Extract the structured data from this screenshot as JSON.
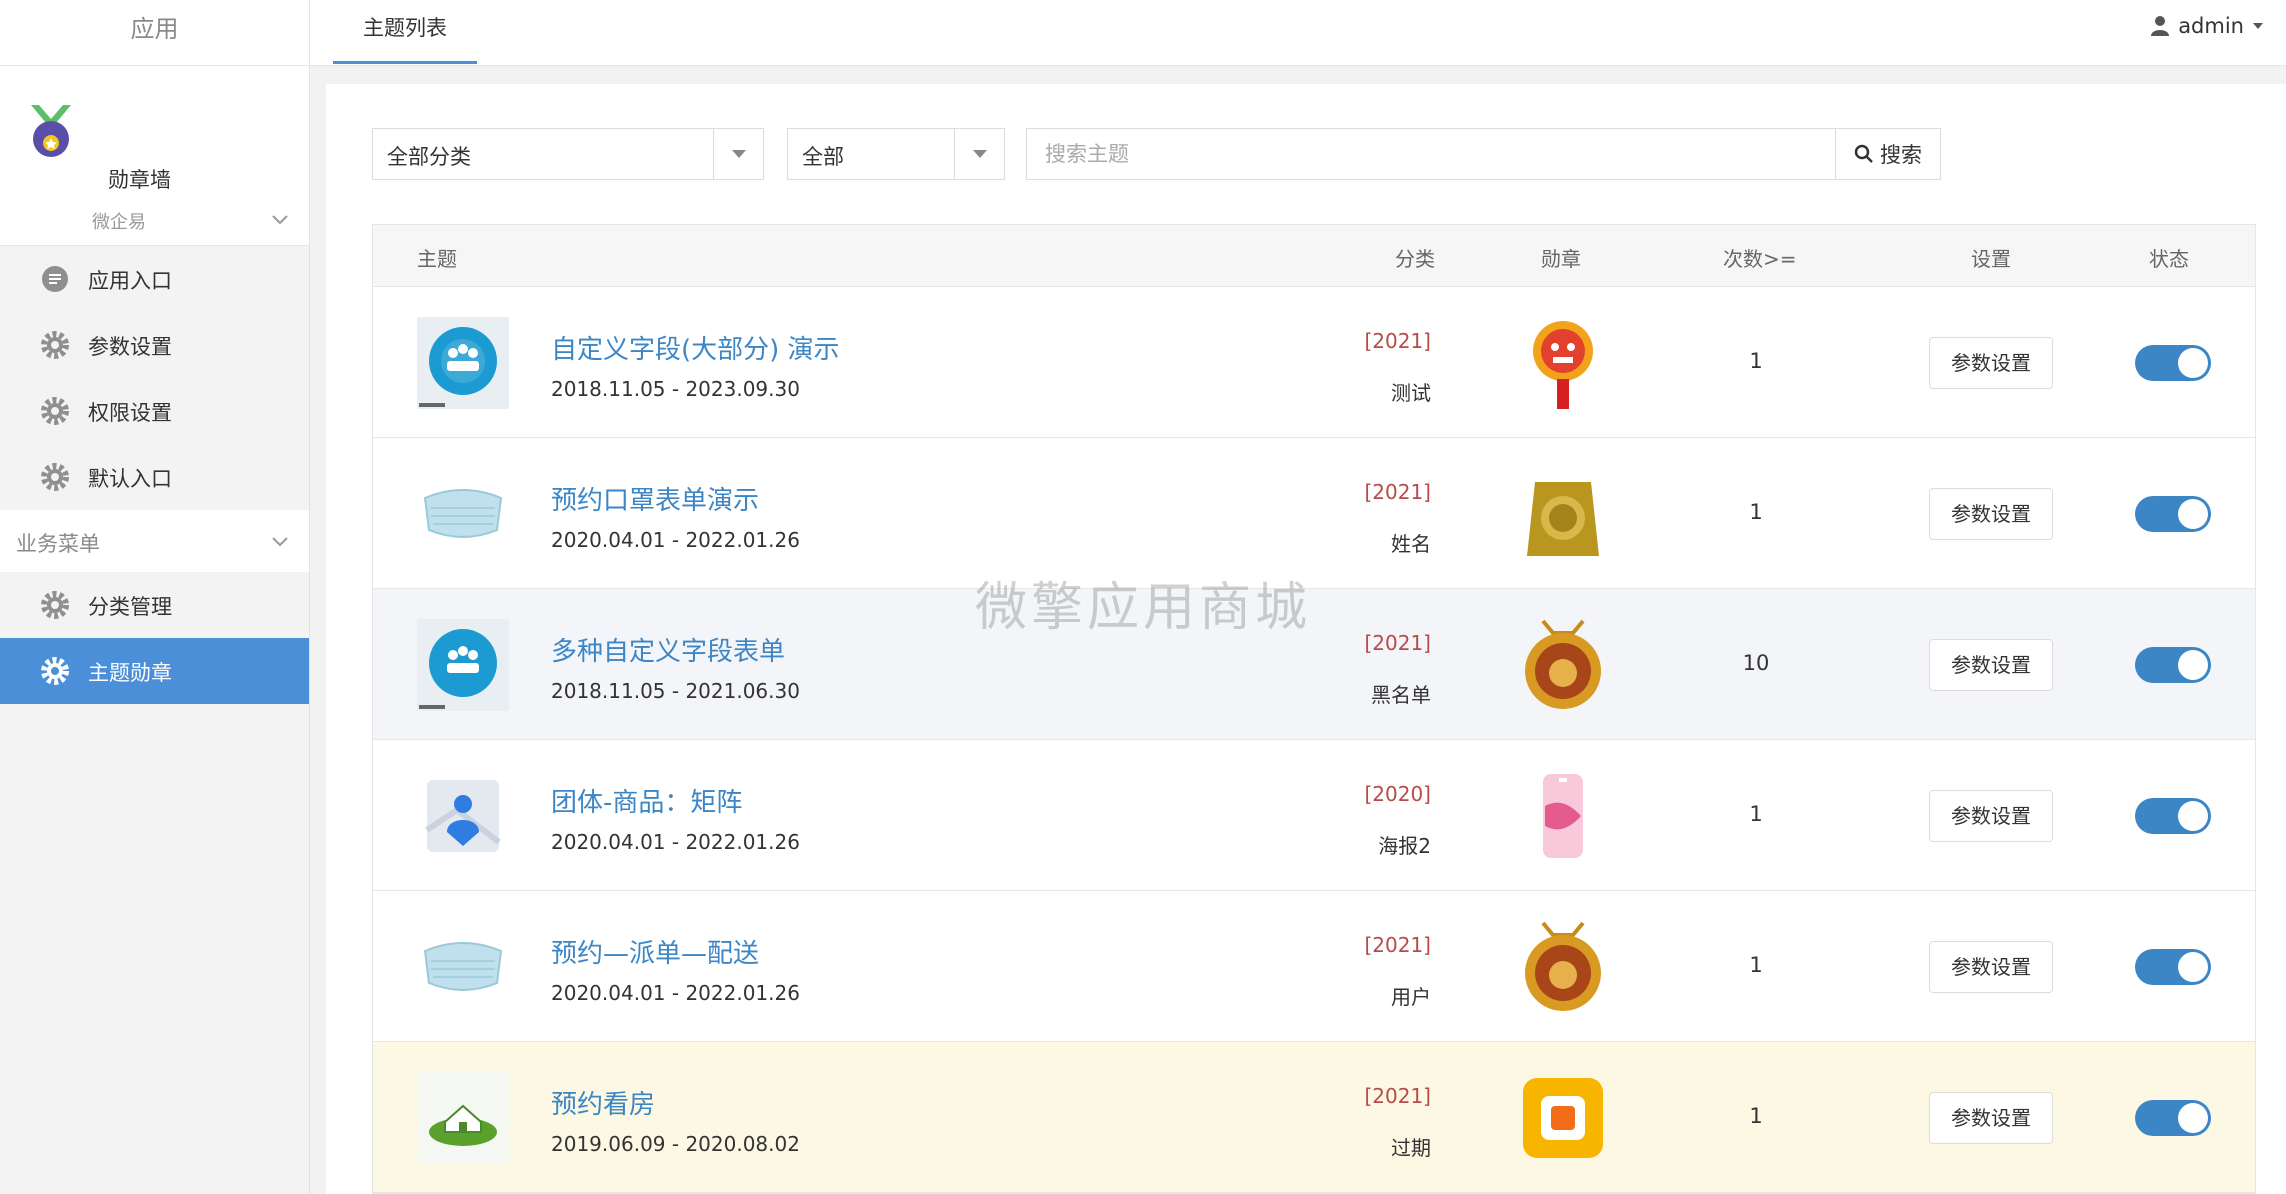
{
  "sidebar": {
    "title": "应用",
    "app_name": "勋章墙",
    "group_label": "微企易",
    "items": [
      {
        "label": "应用入口"
      },
      {
        "label": "参数设置"
      },
      {
        "label": "权限设置"
      },
      {
        "label": "默认入口"
      }
    ],
    "section_label": "业务菜单",
    "section_items": [
      {
        "label": "分类管理"
      },
      {
        "label": "主题勋章"
      }
    ]
  },
  "topbar": {
    "tab": "主题列表",
    "user": "admin"
  },
  "filters": {
    "category": "全部分类",
    "status": "全部",
    "search_placeholder": "搜索主题",
    "search_button": "搜索"
  },
  "table": {
    "headers": [
      "主题",
      "分类",
      "勋章",
      "次数>=",
      "设置",
      "状态"
    ],
    "rows": [
      {
        "title": "自定义字段(大部分) 演示",
        "dates": "2018.11.05 - 2023.09.30",
        "year": "[2021]",
        "category": "测试",
        "count": "1",
        "button": "参数设置",
        "thumb": "people-icon",
        "medal": "lion-medal"
      },
      {
        "title": "预约口罩表单演示",
        "dates": "2020.04.01 - 2022.01.26",
        "year": "[2021]",
        "category": "姓名",
        "count": "1",
        "button": "参数设置",
        "thumb": "mask-icon",
        "medal": "gold-bag-medal"
      },
      {
        "title": "多种自定义字段表单",
        "dates": "2018.11.05 - 2021.06.30",
        "year": "[2021]",
        "category": "黑名单",
        "count": "10",
        "button": "参数设置",
        "thumb": "people-icon",
        "medal": "ox-medal"
      },
      {
        "title": "团体-商品：矩阵",
        "dates": "2020.04.01 - 2022.01.26",
        "year": "[2020]",
        "category": "海报2",
        "count": "1",
        "button": "参数设置",
        "thumb": "map-person-icon",
        "medal": "pink-card-medal"
      },
      {
        "title": "预约—派单—配送",
        "dates": "2020.04.01 - 2022.01.26",
        "year": "[2021]",
        "category": "用户",
        "count": "1",
        "button": "参数设置",
        "thumb": "mask-icon",
        "medal": "ox-medal"
      },
      {
        "title": "预约看房",
        "dates": "2019.06.09 - 2020.08.02",
        "year": "[2021]",
        "category": "过期",
        "count": "1",
        "button": "参数设置",
        "thumb": "house-icon",
        "medal": "orange-square-medal"
      }
    ]
  },
  "watermark": "微擎应用商城"
}
